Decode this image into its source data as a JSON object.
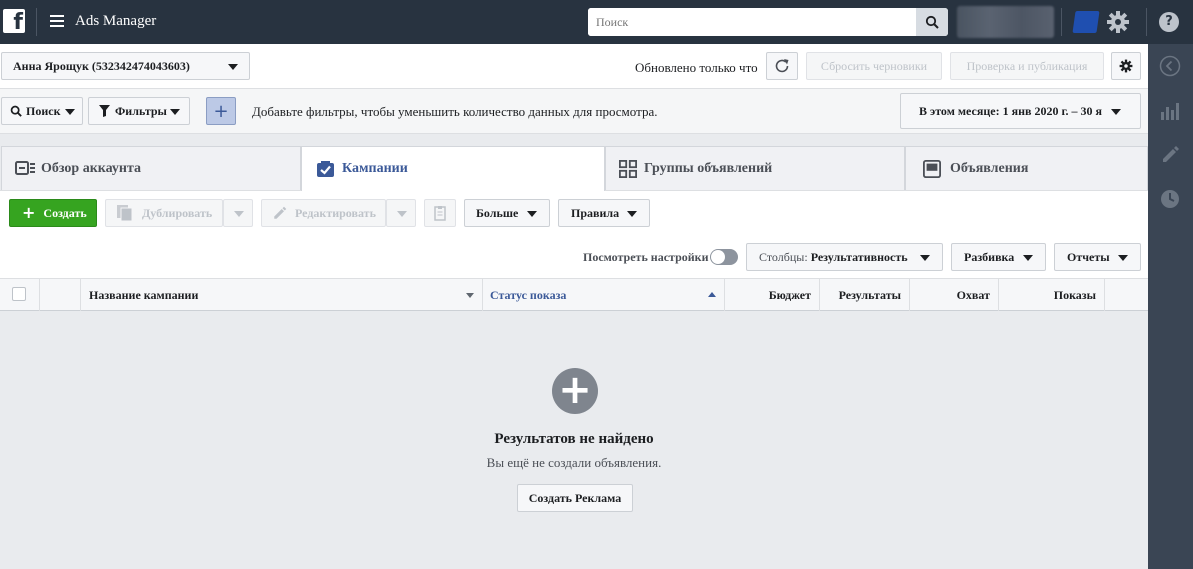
{
  "topbar": {
    "app_title": "Ads Manager",
    "search_placeholder": "Поиск"
  },
  "account_bar": {
    "account_name": "Анна Ярощук (532342474043603)",
    "updated_text": "Обновлено только что",
    "discard_drafts": "Сбросить черновики",
    "review_publish": "Проверка и публикация"
  },
  "filter_bar": {
    "search_label": "Поиск",
    "filters_label": "Фильтры",
    "hint": "Добавьте фильтры, чтобы уменьшить количество данных для просмотра.",
    "date_range": "В этом месяце: 1 янв 2020 г. – 30 я"
  },
  "tabs": [
    {
      "label": "Обзор аккаунта",
      "active": false
    },
    {
      "label": "Кампании",
      "active": true
    },
    {
      "label": "Группы объявлений",
      "active": false
    },
    {
      "label": "Объявления",
      "active": false
    }
  ],
  "toolbar": {
    "create": "Создать",
    "duplicate": "Дублировать",
    "edit": "Редактировать",
    "more": "Больше",
    "rules": "Правила",
    "view_settings": "Посмотреть настройки",
    "columns_prefix": "Столбцы: ",
    "columns_value": "Результативность",
    "breakdown": "Разбивка",
    "reports": "Отчеты"
  },
  "table": {
    "columns": [
      "Название кампании",
      "Статус показа",
      "Бюджет",
      "Результаты",
      "Охват",
      "Показы"
    ]
  },
  "empty_state": {
    "title": "Результатов не найдено",
    "subtitle": "Вы ещё не создали объявления.",
    "button": "Создать Реклама"
  },
  "colors": {
    "topbar_bg": "#283340",
    "accent_blue": "#3b5998",
    "create_green": "#36a420",
    "rail_bg": "#3a4554"
  }
}
